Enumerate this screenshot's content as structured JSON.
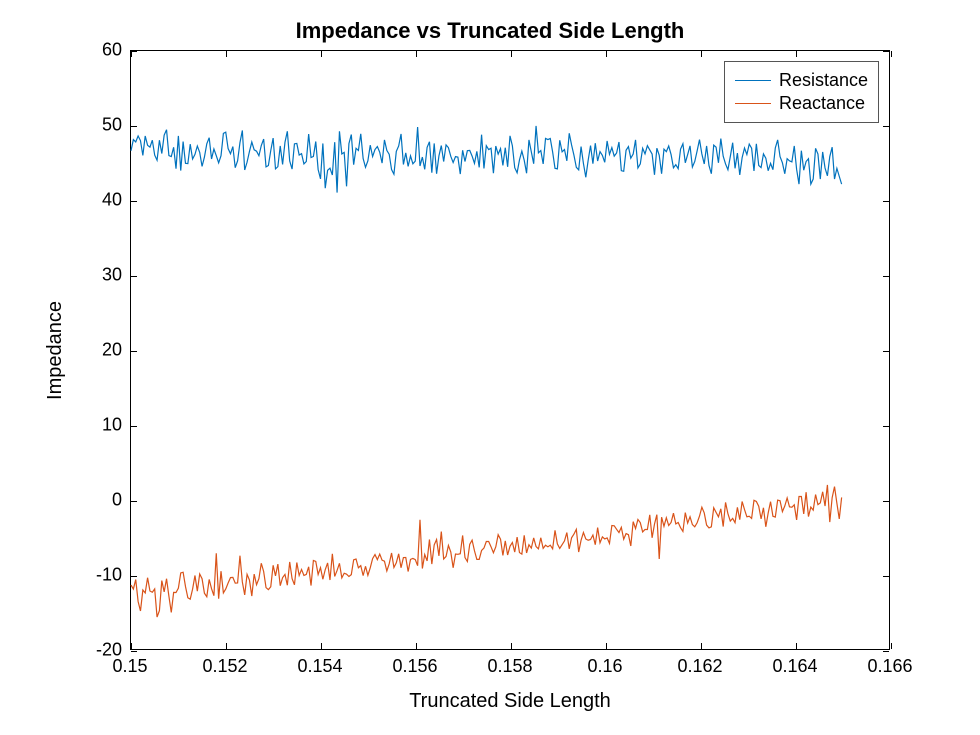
{
  "chart_data": {
    "type": "line",
    "title": "Impedance vs Truncated Side Length",
    "xlabel": "Truncated Side Length",
    "ylabel": "Impedance",
    "xlim": [
      0.15,
      0.166
    ],
    "ylim": [
      -20,
      60
    ],
    "xticks": [
      0.15,
      0.152,
      0.154,
      0.156,
      0.158,
      0.16,
      0.162,
      0.164,
      0.166
    ],
    "yticks": [
      -20,
      -10,
      0,
      10,
      20,
      30,
      40,
      50,
      60
    ],
    "xtick_labels": [
      "0.15",
      "0.152",
      "0.154",
      "0.156",
      "0.158",
      "0.16",
      "0.162",
      "0.164",
      "0.166"
    ],
    "ytick_labels": [
      "-20",
      "-10",
      "0",
      "10",
      "20",
      "30",
      "40",
      "50",
      "60"
    ],
    "legend": {
      "position": "northeast",
      "entries": [
        "Resistance",
        "Reactance"
      ]
    },
    "x": [
      0.15,
      0.15005,
      0.1501,
      0.15015,
      0.1502,
      0.15025,
      0.1503,
      0.15035,
      0.1504,
      0.15045,
      0.1505,
      0.15055,
      0.1506,
      0.15065,
      0.1507,
      0.15075,
      0.1508,
      0.15085,
      0.1509,
      0.15095,
      0.151,
      0.15105,
      0.1511,
      0.15115,
      0.1512,
      0.15125,
      0.1513,
      0.15135,
      0.1514,
      0.15145,
      0.1515,
      0.15155,
      0.1516,
      0.15165,
      0.1517,
      0.15175,
      0.1518,
      0.15185,
      0.1519,
      0.15195,
      0.152,
      0.15205,
      0.1521,
      0.15215,
      0.1522,
      0.15225,
      0.1523,
      0.15235,
      0.1524,
      0.15245,
      0.1525,
      0.15255,
      0.1526,
      0.15265,
      0.1527,
      0.15275,
      0.1528,
      0.15285,
      0.1529,
      0.15295,
      0.153,
      0.15305,
      0.1531,
      0.15315,
      0.1532,
      0.15325,
      0.1533,
      0.15335,
      0.1534,
      0.15345,
      0.1535,
      0.15355,
      0.1536,
      0.15365,
      0.1537,
      0.15375,
      0.1538,
      0.15385,
      0.1539,
      0.15395,
      0.154,
      0.15405,
      0.1541,
      0.15415,
      0.1542,
      0.15425,
      0.1543,
      0.15435,
      0.1544,
      0.15445,
      0.1545,
      0.15455,
      0.1546,
      0.15465,
      0.1547,
      0.15475,
      0.1548,
      0.15485,
      0.1549,
      0.15495,
      0.155,
      0.15505,
      0.1551,
      0.15515,
      0.1552,
      0.15525,
      0.1553,
      0.15535,
      0.1554,
      0.15545,
      0.1555,
      0.15555,
      0.1556,
      0.15565,
      0.1557,
      0.15575,
      0.1558,
      0.15585,
      0.1559,
      0.15595,
      0.156,
      0.15605,
      0.1561,
      0.15615,
      0.1562,
      0.15625,
      0.1563,
      0.15635,
      0.1564,
      0.15645,
      0.1565,
      0.15655,
      0.1566,
      0.15665,
      0.1567,
      0.15675,
      0.1568,
      0.15685,
      0.1569,
      0.15695,
      0.157,
      0.15705,
      0.1571,
      0.15715,
      0.1572,
      0.15725,
      0.1573,
      0.15735,
      0.1574,
      0.15745,
      0.1575,
      0.15755,
      0.1576,
      0.15765,
      0.1577,
      0.15775,
      0.1578,
      0.15785,
      0.1579,
      0.15795,
      0.158,
      0.15805,
      0.1581,
      0.15815,
      0.1582,
      0.15825,
      0.1583,
      0.15835,
      0.1584,
      0.15845,
      0.1585,
      0.15855,
      0.1586,
      0.15865,
      0.1587,
      0.15875,
      0.1588,
      0.15885,
      0.1589,
      0.15895,
      0.159,
      0.15905,
      0.1591,
      0.15915,
      0.1592,
      0.15925,
      0.1593,
      0.15935,
      0.1594,
      0.15945,
      0.1595,
      0.15955,
      0.1596,
      0.15965,
      0.1597,
      0.15975,
      0.1598,
      0.15985,
      0.1599,
      0.15995,
      0.16,
      0.16005,
      0.1601,
      0.16015,
      0.1602,
      0.16025,
      0.1603,
      0.16035,
      0.1604,
      0.16045,
      0.1605,
      0.16055,
      0.1606,
      0.16065,
      0.1607,
      0.16075,
      0.1608,
      0.16085,
      0.1609,
      0.16095,
      0.161,
      0.16105,
      0.1611,
      0.16115,
      0.1612,
      0.16125,
      0.1613,
      0.16135,
      0.1614,
      0.16145,
      0.1615,
      0.16155,
      0.1616,
      0.16165,
      0.1617,
      0.16175,
      0.1618,
      0.16185,
      0.1619,
      0.16195,
      0.162,
      0.16205,
      0.1621,
      0.16215,
      0.1622,
      0.16225,
      0.1623,
      0.16235,
      0.1624,
      0.16245,
      0.1625,
      0.16255,
      0.1626,
      0.16265,
      0.1627,
      0.16275,
      0.1628,
      0.16285,
      0.1629,
      0.16295,
      0.163,
      0.16305,
      0.1631,
      0.16315,
      0.1632,
      0.16325,
      0.1633,
      0.16335,
      0.1634,
      0.16345,
      0.1635,
      0.16355,
      0.1636,
      0.16365,
      0.1637,
      0.16375,
      0.1638,
      0.16385,
      0.1639,
      0.16395,
      0.164,
      0.16405,
      0.1641,
      0.16415,
      0.1642,
      0.16425,
      0.1643,
      0.16435,
      0.1644,
      0.16445,
      0.1645,
      0.16455,
      0.1646,
      0.16465,
      0.1647,
      0.16475,
      0.1648,
      0.16485,
      0.1649,
      0.16495,
      0.165
    ],
    "series": [
      {
        "name": "Resistance",
        "color": "#0072BD",
        "values": [
          46.66,
          48.15,
          47.83,
          48.64,
          48.01,
          46.03,
          48.63,
          47.38,
          47.14,
          48.07,
          46.07,
          45.39,
          48.07,
          46.29,
          48.74,
          49.47,
          46.01,
          45.88,
          47.12,
          44.26,
          48.64,
          44.01,
          47.89,
          44.97,
          44.93,
          47.54,
          45.55,
          46.16,
          47.29,
          46.44,
          44.56,
          45.81,
          47.59,
          48.4,
          45.56,
          46.89,
          45.99,
          45.04,
          45.99,
          48.98,
          49.14,
          46.95,
          46.26,
          47.22,
          44.39,
          45.31,
          47.75,
          49.37,
          44.08,
          45.13,
          46.55,
          47.82,
          46.78,
          46.59,
          45.99,
          47.36,
          48.22,
          44.5,
          44.68,
          46.68,
          48.35,
          44.23,
          44.53,
          47.3,
          44.83,
          47.79,
          49.26,
          45.29,
          44.2,
          47.58,
          47.63,
          46.08,
          46.27,
          44.89,
          45.22,
          48.89,
          45.75,
          45.89,
          47.89,
          44.15,
          42.89,
          47.63,
          41.65,
          44.04,
          44.32,
          43.41,
          47.81,
          41.06,
          49.26,
          46.23,
          46.43,
          41.9,
          47.62,
          48.82,
          44.79,
          46.98,
          46.7,
          48.92,
          45.61,
          44.44,
          45.3,
          47.4,
          45.89,
          46.82,
          47.22,
          46.45,
          45.0,
          48.11,
          46.7,
          46.18,
          44.14,
          43.52,
          46.57,
          47.3,
          48.9,
          44.82,
          46.37,
          44.56,
          45.97,
          44.91,
          45.27,
          49.82,
          44.62,
          45.81,
          44.17,
          47.11,
          47.86,
          43.71,
          47.64,
          43.58,
          45.97,
          47.35,
          45.21,
          47.44,
          47.07,
          45.91,
          45.08,
          45.87,
          45.8,
          43.54,
          46.72,
          45.21,
          46.66,
          46.7,
          45.94,
          44.97,
          46.57,
          44.43,
          48.8,
          44.29,
          47.33,
          46.82,
          47.0,
          43.65,
          47.28,
          46.2,
          46.94,
          44.69,
          47.07,
          44.51,
          48.65,
          47.33,
          44.38,
          43.71,
          45.44,
          46.61,
          45.39,
          43.65,
          48.11,
          46.51,
          44.92,
          49.98,
          46.38,
          46.68,
          44.89,
          48.3,
          48.15,
          48.3,
          46.49,
          44.3,
          44.23,
          48.06,
          46.51,
          46.82,
          45.3,
          48.99,
          47.42,
          46.06,
          44.44,
          44.1,
          47.21,
          44.96,
          43.11,
          45.38,
          47.35,
          44.92,
          47.66,
          45.28,
          46.54,
          46.03,
          45.11,
          47.96,
          46.18,
          47.07,
          45.93,
          46.35,
          47.82,
          43.99,
          43.91,
          46.72,
          47.21,
          45.66,
          46.22,
          48.11,
          44.35,
          44.89,
          46.98,
          46.24,
          47.33,
          46.76,
          46.21,
          43.44,
          47.0,
          46.05,
          43.58,
          46.87,
          46.54,
          47.3,
          46.15,
          44.38,
          44.79,
          44.26,
          46.87,
          47.59,
          45.04,
          46.15,
          47.31,
          44.48,
          45.22,
          46.64,
          48.14,
          46.22,
          44.89,
          47.3,
          44.69,
          43.58,
          47.41,
          47.14,
          45.04,
          48.29,
          45.93,
          44.89,
          44.12,
          45.87,
          47.73,
          44.3,
          46.35,
          43.42,
          45.74,
          47.02,
          46.15,
          47.55,
          47.0,
          43.95,
          47.59,
          44.69,
          44.4,
          46.23,
          45.66,
          43.98,
          44.97,
          44.12,
          47.03,
          48.11,
          45.87,
          45.04,
          43.58,
          45.59,
          45.3,
          45.17,
          47.3,
          44.17,
          42.19,
          46.66,
          44.05,
          45.22,
          45.59,
          42.19,
          42.87,
          46.98,
          46.22,
          42.87,
          46.5,
          44.35,
          43.3,
          45.88,
          47.13,
          42.87,
          44.3,
          43.23,
          42.19
        ]
      },
      {
        "name": "Reactance",
        "color": "#D95319",
        "values": [
          -11.44,
          -11.98,
          -10.71,
          -13.64,
          -14.91,
          -12.11,
          -12.5,
          -10.46,
          -12.24,
          -12.41,
          -11.97,
          -15.73,
          -14.86,
          -10.85,
          -12.36,
          -10.6,
          -12.94,
          -15.11,
          -12.43,
          -12.44,
          -11.86,
          -9.83,
          -9.73,
          -11.64,
          -13.14,
          -13.33,
          -11.99,
          -10.17,
          -12.26,
          -9.97,
          -10.6,
          -12.54,
          -13.01,
          -10.69,
          -11.93,
          -12.87,
          -7.2,
          -13.27,
          -9.59,
          -12.5,
          -11.97,
          -11.17,
          -10.45,
          -10.42,
          -11.18,
          -11.16,
          -7.51,
          -11.03,
          -12.76,
          -10.01,
          -10.77,
          -12.91,
          -9.98,
          -11.4,
          -10.58,
          -8.53,
          -9.63,
          -11.79,
          -12.06,
          -11.67,
          -8.8,
          -10.22,
          -8.64,
          -11.53,
          -10.45,
          -10.02,
          -11.47,
          -8.35,
          -10.58,
          -11.41,
          -8.43,
          -10.16,
          -9.36,
          -10.16,
          -10.02,
          -9.01,
          -11.52,
          -8.16,
          -8.28,
          -10.03,
          -9.12,
          -10.67,
          -9.38,
          -8.49,
          -10.77,
          -7.27,
          -10.29,
          -9.49,
          -8.54,
          -10.48,
          -9.86,
          -9.99,
          -10.3,
          -10.05,
          -8.07,
          -7.96,
          -9.13,
          -8.85,
          -10.18,
          -8.93,
          -10.14,
          -9.14,
          -7.9,
          -7.37,
          -8.05,
          -7.3,
          -8.12,
          -8.25,
          -9.56,
          -8.6,
          -7.16,
          -9.1,
          -8.47,
          -7.27,
          -9.13,
          -7.77,
          -7.76,
          -9.63,
          -8.01,
          -7.88,
          -8.03,
          -8.85,
          -2.71,
          -9.23,
          -7.37,
          -8.22,
          -5.35,
          -8.63,
          -6.08,
          -5.35,
          -7.54,
          -4.29,
          -7.96,
          -7.62,
          -6.15,
          -7.03,
          -9.13,
          -7.3,
          -7.33,
          -7.26,
          -4.81,
          -7.77,
          -8.3,
          -5.99,
          -5.44,
          -6.86,
          -8.01,
          -8.01,
          -6.82,
          -6.5,
          -5.62,
          -5.62,
          -6.33,
          -7.12,
          -6.33,
          -4.71,
          -5.31,
          -7.48,
          -5.54,
          -7.42,
          -6.26,
          -5.75,
          -7.03,
          -5.03,
          -7.1,
          -7.3,
          -4.8,
          -7.15,
          -6.05,
          -6.5,
          -5.14,
          -6.3,
          -6.6,
          -5.12,
          -6.54,
          -6.12,
          -6.33,
          -6.11,
          -6.6,
          -4.13,
          -5.94,
          -6.54,
          -6.05,
          -5.54,
          -4.42,
          -6.6,
          -5.12,
          -4.63,
          -4.0,
          -7.03,
          -5.45,
          -4.42,
          -5.28,
          -5.45,
          -5.35,
          -4.75,
          -6.05,
          -3.76,
          -5.79,
          -5.0,
          -5.28,
          -5.14,
          -5.87,
          -3.48,
          -3.52,
          -3.99,
          -4.42,
          -3.72,
          -5.31,
          -4.56,
          -4.71,
          -6.22,
          -2.96,
          -3.88,
          -2.67,
          -3.1,
          -4.34,
          -4.01,
          -4.01,
          -2.05,
          -5.12,
          -3.29,
          -2.03,
          -7.95,
          -2.36,
          -3.59,
          -2.44,
          -3.48,
          -3.08,
          -1.83,
          -3.27,
          -3.08,
          -3.77,
          -4.27,
          -1.75,
          -3.15,
          -2.31,
          -3.35,
          -3.65,
          -3.11,
          -2.22,
          -1.03,
          -1.8,
          -3.42,
          -3.8,
          -3.65,
          -1.11,
          -1.72,
          -2.31,
          -1.25,
          -3.62,
          -0.39,
          -1.9,
          -2.89,
          -2.53,
          -3.1,
          -1.05,
          -2.69,
          -0.27,
          -1.34,
          -2.31,
          -2.24,
          -2.53,
          -0.11,
          -0.26,
          -0.9,
          -2.6,
          -1.11,
          -3.65,
          -1.79,
          -0.29,
          -2.24,
          -2.35,
          -0.08,
          -0.17,
          -1.62,
          -0.87,
          0.21,
          -0.99,
          -1.04,
          -0.71,
          -2.73,
          0.4,
          0.4,
          -1.93,
          0.98,
          -2.29,
          -1.01,
          -1.43,
          0.66,
          -0.68,
          -0.45,
          1.03,
          -0.87,
          1.95,
          -3.02,
          0.24,
          1.72,
          -0.5,
          -2.6,
          0.27
        ]
      }
    ]
  }
}
